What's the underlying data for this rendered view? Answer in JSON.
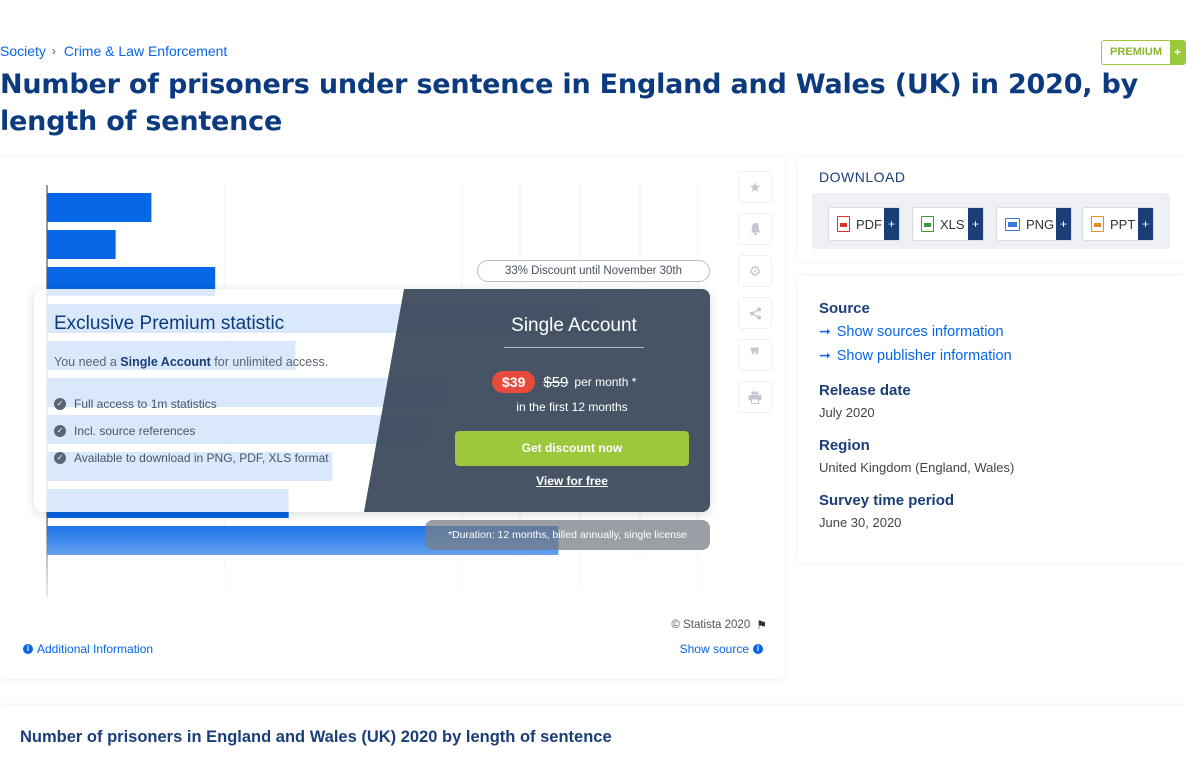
{
  "breadcrumb": {
    "items": [
      "Society",
      "Crime & Law Enforcement"
    ],
    "separator": "›"
  },
  "premium_badge": {
    "label": "PREMIUM",
    "plus": "+"
  },
  "page_title": "Number of prisoners under sentence in England and Wales (UK) in 2020, by length of sentence",
  "chart_data": {
    "type": "bar",
    "orientation": "horizontal",
    "title": "",
    "categories": [],
    "values": [
      108,
      71,
      174,
      570,
      257,
      413,
      392,
      295,
      250,
      529
    ],
    "note": "values obscured by premium overlay; relative bar lengths only",
    "color": "#0666e5",
    "grid": true
  },
  "tools": {
    "star": "star-icon",
    "bell": "bell-icon",
    "gear": "gear-icon",
    "share": "share-icon",
    "quote": "quote-icon",
    "print": "print-icon"
  },
  "overlay": {
    "discount": "33% Discount until November 30th",
    "title": "Exclusive Premium statistic",
    "need_prefix": "You need a",
    "need_bold": "Single Account",
    "need_suffix": "for unlimited access.",
    "features": [
      "Full access to 1m statistics",
      "Incl. source references",
      "Available to download in PNG, PDF, XLS format"
    ],
    "single_title": "Single Account",
    "price_new": "$39",
    "price_old": "$59",
    "per_month": "per month *",
    "first_months": "in the first 12 months",
    "cta": "Get discount now",
    "view_free": "View for free",
    "duration": "*Duration: 12 months, billed annually, single license"
  },
  "footer": {
    "copyright": "© Statista 2020",
    "additional": "Additional Information",
    "show_source": "Show source"
  },
  "download": {
    "title": "DOWNLOAD",
    "buttons": [
      {
        "label": "PDF",
        "plus": "+",
        "color": "#d9342b"
      },
      {
        "label": "XLS",
        "plus": "+",
        "color": "#3a9a3a"
      },
      {
        "label": "PNG",
        "plus": "+",
        "color": "#3a7bd5"
      },
      {
        "label": "PPT",
        "plus": "+",
        "color": "#e8892b"
      }
    ]
  },
  "meta": {
    "source_h": "Source",
    "show_sources": "Show sources information",
    "show_publisher": "Show publisher information",
    "release_h": "Release date",
    "release_v": "July 2020",
    "region_h": "Region",
    "region_v": "United Kingdom (England, Wales)",
    "survey_h": "Survey time period",
    "survey_v": "June 30, 2020"
  },
  "bottom_title": "Number of prisoners in England and Wales (UK) 2020 by length of sentence"
}
